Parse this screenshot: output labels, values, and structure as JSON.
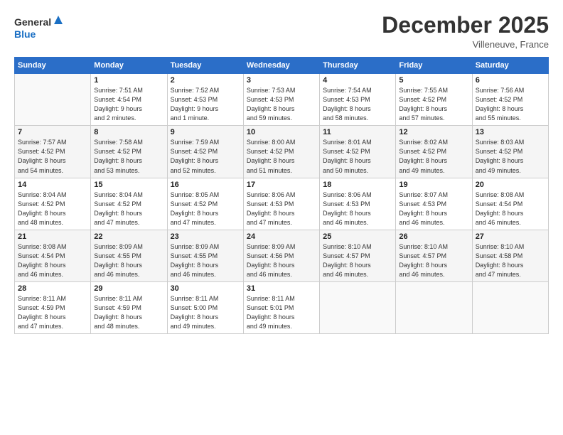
{
  "logo": {
    "line1": "General",
    "line2": "Blue"
  },
  "title": "December 2025",
  "subtitle": "Villeneuve, France",
  "days_header": [
    "Sunday",
    "Monday",
    "Tuesday",
    "Wednesday",
    "Thursday",
    "Friday",
    "Saturday"
  ],
  "weeks": [
    [
      {
        "num": "",
        "info": ""
      },
      {
        "num": "1",
        "info": "Sunrise: 7:51 AM\nSunset: 4:54 PM\nDaylight: 9 hours\nand 2 minutes."
      },
      {
        "num": "2",
        "info": "Sunrise: 7:52 AM\nSunset: 4:53 PM\nDaylight: 9 hours\nand 1 minute."
      },
      {
        "num": "3",
        "info": "Sunrise: 7:53 AM\nSunset: 4:53 PM\nDaylight: 8 hours\nand 59 minutes."
      },
      {
        "num": "4",
        "info": "Sunrise: 7:54 AM\nSunset: 4:53 PM\nDaylight: 8 hours\nand 58 minutes."
      },
      {
        "num": "5",
        "info": "Sunrise: 7:55 AM\nSunset: 4:52 PM\nDaylight: 8 hours\nand 57 minutes."
      },
      {
        "num": "6",
        "info": "Sunrise: 7:56 AM\nSunset: 4:52 PM\nDaylight: 8 hours\nand 55 minutes."
      }
    ],
    [
      {
        "num": "7",
        "info": "Sunrise: 7:57 AM\nSunset: 4:52 PM\nDaylight: 8 hours\nand 54 minutes."
      },
      {
        "num": "8",
        "info": "Sunrise: 7:58 AM\nSunset: 4:52 PM\nDaylight: 8 hours\nand 53 minutes."
      },
      {
        "num": "9",
        "info": "Sunrise: 7:59 AM\nSunset: 4:52 PM\nDaylight: 8 hours\nand 52 minutes."
      },
      {
        "num": "10",
        "info": "Sunrise: 8:00 AM\nSunset: 4:52 PM\nDaylight: 8 hours\nand 51 minutes."
      },
      {
        "num": "11",
        "info": "Sunrise: 8:01 AM\nSunset: 4:52 PM\nDaylight: 8 hours\nand 50 minutes."
      },
      {
        "num": "12",
        "info": "Sunrise: 8:02 AM\nSunset: 4:52 PM\nDaylight: 8 hours\nand 49 minutes."
      },
      {
        "num": "13",
        "info": "Sunrise: 8:03 AM\nSunset: 4:52 PM\nDaylight: 8 hours\nand 49 minutes."
      }
    ],
    [
      {
        "num": "14",
        "info": "Sunrise: 8:04 AM\nSunset: 4:52 PM\nDaylight: 8 hours\nand 48 minutes."
      },
      {
        "num": "15",
        "info": "Sunrise: 8:04 AM\nSunset: 4:52 PM\nDaylight: 8 hours\nand 47 minutes."
      },
      {
        "num": "16",
        "info": "Sunrise: 8:05 AM\nSunset: 4:52 PM\nDaylight: 8 hours\nand 47 minutes."
      },
      {
        "num": "17",
        "info": "Sunrise: 8:06 AM\nSunset: 4:53 PM\nDaylight: 8 hours\nand 47 minutes."
      },
      {
        "num": "18",
        "info": "Sunrise: 8:06 AM\nSunset: 4:53 PM\nDaylight: 8 hours\nand 46 minutes."
      },
      {
        "num": "19",
        "info": "Sunrise: 8:07 AM\nSunset: 4:53 PM\nDaylight: 8 hours\nand 46 minutes."
      },
      {
        "num": "20",
        "info": "Sunrise: 8:08 AM\nSunset: 4:54 PM\nDaylight: 8 hours\nand 46 minutes."
      }
    ],
    [
      {
        "num": "21",
        "info": "Sunrise: 8:08 AM\nSunset: 4:54 PM\nDaylight: 8 hours\nand 46 minutes."
      },
      {
        "num": "22",
        "info": "Sunrise: 8:09 AM\nSunset: 4:55 PM\nDaylight: 8 hours\nand 46 minutes."
      },
      {
        "num": "23",
        "info": "Sunrise: 8:09 AM\nSunset: 4:55 PM\nDaylight: 8 hours\nand 46 minutes."
      },
      {
        "num": "24",
        "info": "Sunrise: 8:09 AM\nSunset: 4:56 PM\nDaylight: 8 hours\nand 46 minutes."
      },
      {
        "num": "25",
        "info": "Sunrise: 8:10 AM\nSunset: 4:57 PM\nDaylight: 8 hours\nand 46 minutes."
      },
      {
        "num": "26",
        "info": "Sunrise: 8:10 AM\nSunset: 4:57 PM\nDaylight: 8 hours\nand 46 minutes."
      },
      {
        "num": "27",
        "info": "Sunrise: 8:10 AM\nSunset: 4:58 PM\nDaylight: 8 hours\nand 47 minutes."
      }
    ],
    [
      {
        "num": "28",
        "info": "Sunrise: 8:11 AM\nSunset: 4:59 PM\nDaylight: 8 hours\nand 47 minutes."
      },
      {
        "num": "29",
        "info": "Sunrise: 8:11 AM\nSunset: 4:59 PM\nDaylight: 8 hours\nand 48 minutes."
      },
      {
        "num": "30",
        "info": "Sunrise: 8:11 AM\nSunset: 5:00 PM\nDaylight: 8 hours\nand 49 minutes."
      },
      {
        "num": "31",
        "info": "Sunrise: 8:11 AM\nSunset: 5:01 PM\nDaylight: 8 hours\nand 49 minutes."
      },
      {
        "num": "",
        "info": ""
      },
      {
        "num": "",
        "info": ""
      },
      {
        "num": "",
        "info": ""
      }
    ]
  ]
}
